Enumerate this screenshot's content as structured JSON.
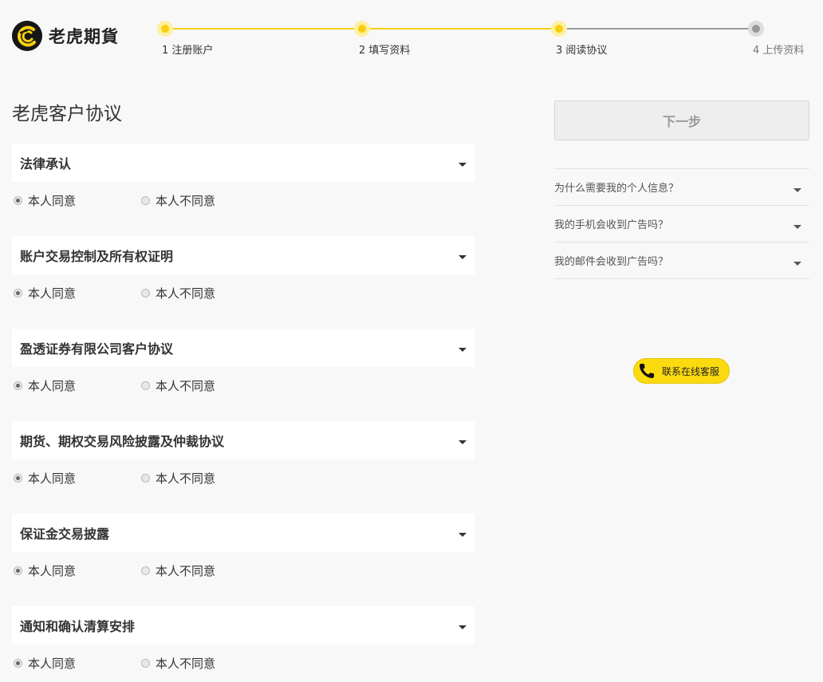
{
  "brand": {
    "name": "老虎期貨"
  },
  "steps": [
    {
      "label": "1 注册账户",
      "state": "done"
    },
    {
      "label": "2 填写资料",
      "state": "done"
    },
    {
      "label": "3 阅读协议",
      "state": "current"
    },
    {
      "label": "4 上传资料",
      "state": "pending"
    }
  ],
  "page": {
    "title": "老虎客户协议"
  },
  "agreements": [
    {
      "title": "法律承认",
      "agree_label": "本人同意",
      "disagree_label": "本人不同意",
      "selected": "agree"
    },
    {
      "title": "账户交易控制及所有权证明",
      "agree_label": "本人同意",
      "disagree_label": "本人不同意",
      "selected": "agree"
    },
    {
      "title": "盈透证券有限公司客户协议",
      "agree_label": "本人同意",
      "disagree_label": "本人不同意",
      "selected": "agree"
    },
    {
      "title": "期货、期权交易风险披露及仲裁协议",
      "agree_label": "本人同意",
      "disagree_label": "本人不同意",
      "selected": "agree"
    },
    {
      "title": "保证金交易披露",
      "agree_label": "本人同意",
      "disagree_label": "本人不同意",
      "selected": "agree"
    },
    {
      "title": "通知和确认清算安排",
      "agree_label": "本人同意",
      "disagree_label": "本人不同意",
      "selected": "agree"
    }
  ],
  "next_button": {
    "label": "下一步",
    "enabled": false
  },
  "faq": [
    {
      "question": "为什么需要我的个人信息？"
    },
    {
      "question": "我的手机会收到广告吗？"
    },
    {
      "question": "我的邮件会收到广告吗？"
    }
  ],
  "support": {
    "label": "联系在线客服"
  },
  "colors": {
    "accent": "#f8cf0e",
    "step_line_done": "#f8cf0e",
    "step_line_pending": "#999999",
    "background": "#f8f8f8"
  }
}
